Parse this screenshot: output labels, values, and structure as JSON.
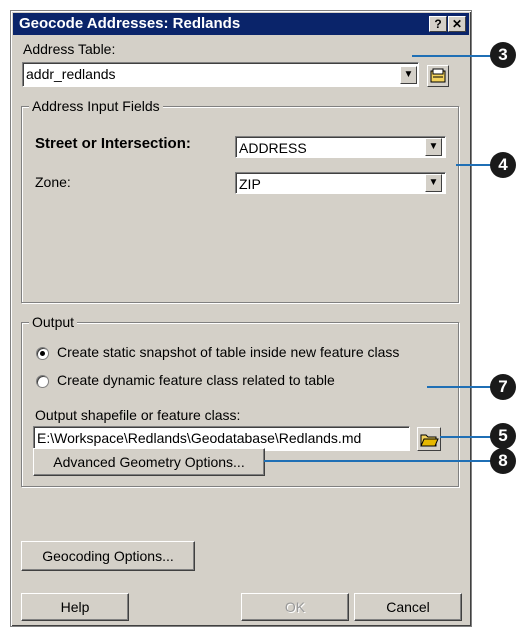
{
  "window": {
    "title": "Geocode Addresses:  Redlands",
    "help_glyph": "?",
    "close_glyph": "✕"
  },
  "address_table": {
    "label": "Address Table:",
    "value": "addr_redlands",
    "dropdown_glyph": "▼"
  },
  "input_fields": {
    "group_label": "Address Input Fields",
    "street_label": "Street or Intersection:",
    "street_value": "ADDRESS",
    "zone_label": "Zone:",
    "zone_value": "ZIP"
  },
  "output": {
    "group_label": "Output",
    "radio_static": "Create static snapshot of table inside new feature class",
    "radio_dynamic": "Create dynamic feature class related to table",
    "output_label": "Output shapefile or feature class:",
    "output_value": "E:\\Workspace\\Redlands\\Geodatabase\\Redlands.md",
    "advanced_button": "Advanced Geometry Options..."
  },
  "geocoding_button": "Geocoding Options...",
  "footer": {
    "help": "Help",
    "ok": "OK",
    "cancel": "Cancel"
  },
  "callouts": [
    "3",
    "4",
    "7",
    "5",
    "8"
  ]
}
